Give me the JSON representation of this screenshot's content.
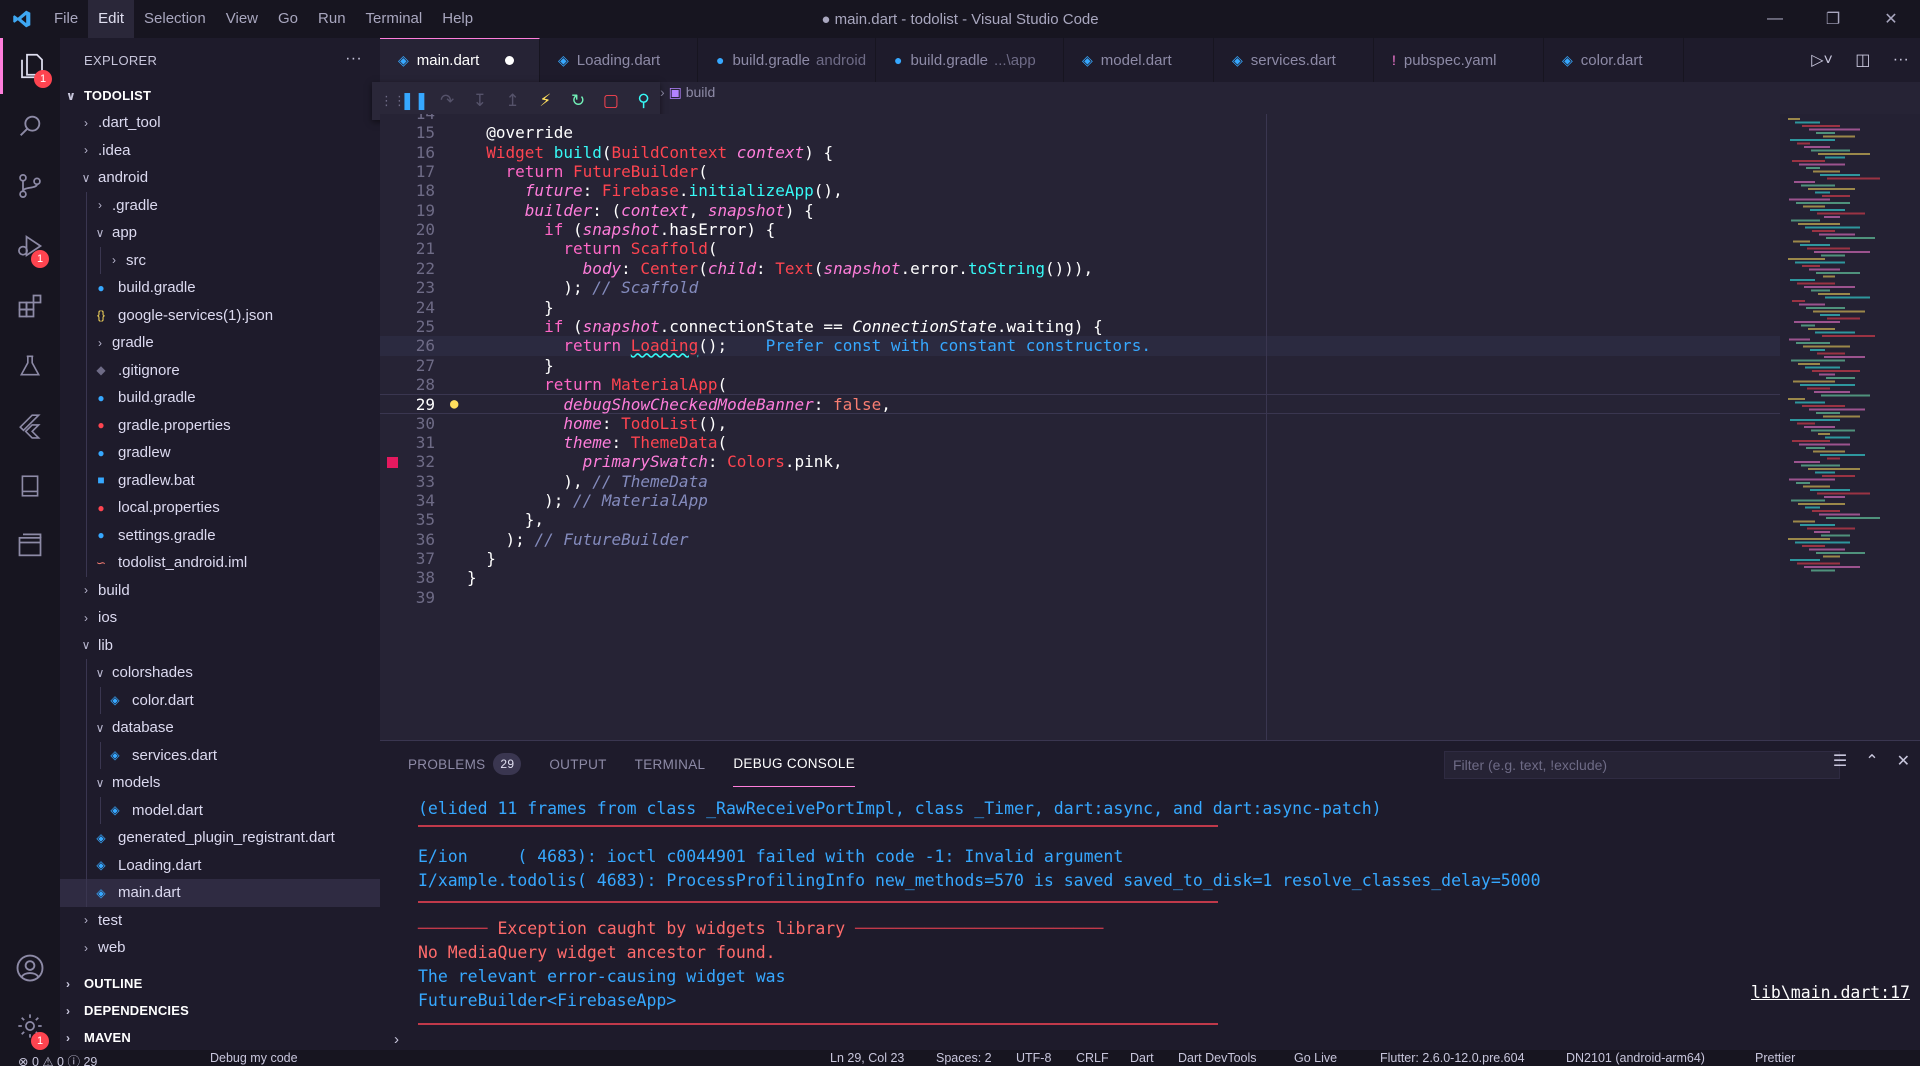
{
  "title_bar": {
    "menus": [
      "File",
      "Edit",
      "Selection",
      "View",
      "Go",
      "Run",
      "Terminal",
      "Help"
    ],
    "active_menu": "Edit",
    "window_title": "● main.dart - todolist - Visual Studio Code"
  },
  "activity_bar": {
    "explorer_badge": "1",
    "debug_badge": "1",
    "settings_badge": "1"
  },
  "sidebar": {
    "header": "EXPLORER",
    "more": "···",
    "root": "TODOLIST",
    "items": [
      {
        "label": ".dart_tool",
        "depth": 0,
        "type": "folder",
        "open": false
      },
      {
        "label": ".idea",
        "depth": 0,
        "type": "folder",
        "open": false
      },
      {
        "label": "android",
        "depth": 0,
        "type": "folder",
        "open": true
      },
      {
        "label": ".gradle",
        "depth": 1,
        "type": "folder",
        "open": false
      },
      {
        "label": "app",
        "depth": 1,
        "type": "folder",
        "open": true
      },
      {
        "label": "src",
        "depth": 2,
        "type": "folder",
        "open": false
      },
      {
        "label": "build.gradle",
        "depth": 1,
        "type": "gradle"
      },
      {
        "label": "google-services(1).json",
        "depth": 1,
        "type": "json"
      },
      {
        "label": "gradle",
        "depth": 1,
        "type": "folder",
        "open": false
      },
      {
        "label": ".gitignore",
        "depth": 1,
        "type": "git"
      },
      {
        "label": "build.gradle",
        "depth": 1,
        "type": "gradle"
      },
      {
        "label": "gradle.properties",
        "depth": 1,
        "type": "props"
      },
      {
        "label": "gradlew",
        "depth": 1,
        "type": "gradle"
      },
      {
        "label": "gradlew.bat",
        "depth": 1,
        "type": "bat"
      },
      {
        "label": "local.properties",
        "depth": 1,
        "type": "props"
      },
      {
        "label": "settings.gradle",
        "depth": 1,
        "type": "gradle"
      },
      {
        "label": "todolist_android.iml",
        "depth": 1,
        "type": "rss"
      },
      {
        "label": "build",
        "depth": 0,
        "type": "folder",
        "open": false
      },
      {
        "label": "ios",
        "depth": 0,
        "type": "folder",
        "open": false
      },
      {
        "label": "lib",
        "depth": 0,
        "type": "folder",
        "open": true
      },
      {
        "label": "colorshades",
        "depth": 1,
        "type": "folder",
        "open": true
      },
      {
        "label": "color.dart",
        "depth": 2,
        "type": "dart"
      },
      {
        "label": "database",
        "depth": 1,
        "type": "folder",
        "open": true
      },
      {
        "label": "services.dart",
        "depth": 2,
        "type": "dart"
      },
      {
        "label": "models",
        "depth": 1,
        "type": "folder",
        "open": true
      },
      {
        "label": "model.dart",
        "depth": 2,
        "type": "dart"
      },
      {
        "label": "generated_plugin_registrant.dart",
        "depth": 1,
        "type": "dart"
      },
      {
        "label": "Loading.dart",
        "depth": 1,
        "type": "dart"
      },
      {
        "label": "main.dart",
        "depth": 1,
        "type": "dart",
        "selected": true
      },
      {
        "label": "test",
        "depth": 0,
        "type": "folder",
        "open": false
      },
      {
        "label": "web",
        "depth": 0,
        "type": "folder",
        "open": false
      }
    ],
    "sections": [
      "OUTLINE",
      "DEPENDENCIES",
      "MAVEN"
    ]
  },
  "tabs": [
    {
      "label": "main.dart",
      "active": true,
      "dirty": true
    },
    {
      "label": "Loading.dart"
    },
    {
      "label": "build.gradle",
      "suffix": "android",
      "gradle": true
    },
    {
      "label": "build.gradle",
      "suffix": "...\\app",
      "gradle": true
    },
    {
      "label": "model.dart"
    },
    {
      "label": "services.dart"
    },
    {
      "label": "pubspec.yaml",
      "yaml": true
    },
    {
      "label": "color.dart"
    }
  ],
  "breadcrumb": "build",
  "editor": {
    "current_line": "29",
    "lines": [
      {
        "n": "14",
        "html": ""
      },
      {
        "n": "15",
        "html": "  <span class='anno'>@override</span>"
      },
      {
        "n": "16",
        "html": "  <span class='ty'>Widget</span> <span class='fn'>build</span><span class='pl'>(</span><span class='ty'>BuildContext</span> <span class='param'>context</span><span class='pl'>) {</span>"
      },
      {
        "n": "17",
        "html": "    <span class='kwp'>return</span> <span class='ty'>FutureBuilder</span><span class='pl'>(</span>"
      },
      {
        "n": "18",
        "html": "      <span class='param'>future</span><span class='pl'>: </span><span class='ty'>Firebase</span><span class='pl'>.</span><span class='fn'>initializeApp</span><span class='pl'>(),</span>"
      },
      {
        "n": "19",
        "html": "      <span class='param'>builder</span><span class='pl'>: (</span><span class='param'>context</span><span class='pl'>, </span><span class='param'>snapshot</span><span class='pl'>) {</span>"
      },
      {
        "n": "20",
        "html": "        <span class='kwp'>if</span> <span class='pl'>(</span><span class='param'>snapshot</span><span class='pl'>.hasError) {</span>"
      },
      {
        "n": "21",
        "html": "          <span class='kwp'>return</span> <span class='ty'>Scaffold</span><span class='pl'>(</span>"
      },
      {
        "n": "22",
        "html": "            <span class='param'>body</span><span class='pl'>: </span><span class='ty'>Center</span><span class='pl'>(</span><span class='param'>child</span><span class='pl'>: </span><span class='ty'>Text</span><span class='pl'>(</span><span class='param'>snapshot</span><span class='pl'>.error.</span><span class='fn'>toString</span><span class='pl'>())),</span>"
      },
      {
        "n": "23",
        "html": "          <span class='pl'>); </span><span class='cm'>// Scaffold</span>"
      },
      {
        "n": "24",
        "html": "        <span class='pl'>}</span>"
      },
      {
        "n": "25",
        "html": "        <span class='kwp'>if</span> <span class='pl'>(</span><span class='param'>snapshot</span><span class='pl'>.connectionState == </span><span class='ital' style='color:#ffffff'>ConnectionState</span><span class='pl'>.waiting) {</span>"
      },
      {
        "n": "26",
        "html": "          <span class='kwp'>return</span> <span class='ty' style='text-decoration: underline wavy #36f9f6'>Loading</span><span class='pl'>();</span>    <span class='fn' style='color:#36a8ff'>Prefer const with constant constructors.</span>",
        "hl": true
      },
      {
        "n": "27",
        "html": "        <span class='pl'>}</span>"
      },
      {
        "n": "28",
        "html": "        <span class='kwp'>return</span> <span class='ty'>MaterialApp</span><span class='pl'>(</span>"
      },
      {
        "n": "29",
        "html": "          <span class='param'>debugShowCheckedModeBanner</span><span class='pl'>: </span><span class='val'>false</span><span class='pl'>,</span>",
        "cur": true
      },
      {
        "n": "30",
        "html": "          <span class='param'>home</span><span class='pl'>: </span><span class='ty'>TodoList</span><span class='pl'>(),</span>"
      },
      {
        "n": "31",
        "html": "          <span class='param'>theme</span><span class='pl'>: </span><span class='ty'>ThemeData</span><span class='pl'>(</span>"
      },
      {
        "n": "32",
        "html": "            <span class='param'>primarySwatch</span><span class='pl'>: </span><span class='ty'>Colors</span><span class='pl'>.pink,</span>",
        "bp": true
      },
      {
        "n": "33",
        "html": "          <span class='pl'>), </span><span class='cm'>// ThemeData</span>"
      },
      {
        "n": "34",
        "html": "        <span class='pl'>); </span><span class='cm'>// MaterialApp</span>"
      },
      {
        "n": "35",
        "html": "      <span class='pl'>},</span>"
      },
      {
        "n": "36",
        "html": "    <span class='pl'>); </span><span class='cm'>// FutureBuilder</span>"
      },
      {
        "n": "37",
        "html": "  <span class='pl'>}</span>"
      },
      {
        "n": "38",
        "html": "<span class='pl'>}</span>"
      },
      {
        "n": "39",
        "html": ""
      }
    ]
  },
  "panel": {
    "tabs": [
      {
        "label": "PROBLEMS",
        "count": "29"
      },
      {
        "label": "OUTPUT"
      },
      {
        "label": "TERMINAL"
      },
      {
        "label": "DEBUG CONSOLE",
        "active": true
      }
    ],
    "filter_placeholder": "Filter (e.g. text, !exclude)",
    "console": [
      {
        "text": "(elided 11 frames from class _RawReceivePortImpl, class _Timer, dart:async, and dart:async-patch)",
        "cls": "c-blue"
      },
      {
        "text": "E/ion     ( 4683): ioctl c0044901 failed with code -1: Invalid argument",
        "cls": "c-blue"
      },
      {
        "text": "I/xample.todolis( 4683): ProcessProfilingInfo new_methods=570 is saved saved_to_disk=1 resolve_classes_delay=5000",
        "cls": "c-blue"
      },
      {
        "text": "Exception caught by widgets library",
        "cls": "c-red"
      },
      {
        "text": "No MediaQuery widget ancestor found.",
        "cls": "c-red"
      },
      {
        "text": "The relevant error-causing widget was",
        "cls": "c-blue"
      },
      {
        "text": "FutureBuilder<FirebaseApp>",
        "cls": "c-blue"
      }
    ],
    "link": "lib\\main.dart:17",
    "prompt": "›"
  },
  "status_bar": {
    "items": [
      {
        "text": "⊗ 0  ⚠ 0  ⓘ 29"
      },
      {
        "text": "Debug my code"
      },
      {
        "text": "Ln 29, Col 23"
      },
      {
        "text": "Spaces: 2"
      },
      {
        "text": "UTF-8"
      },
      {
        "text": "CRLF"
      },
      {
        "text": "Dart"
      },
      {
        "text": "Dart DevTools"
      },
      {
        "text": "Go Live"
      },
      {
        "text": "Flutter: 2.6.0-12.0.pre.604"
      },
      {
        "text": "DN2101 (android-arm64)"
      },
      {
        "text": "Prettier"
      }
    ]
  },
  "colors": {
    "accent": "#ff7edb",
    "background": "#262335",
    "sidebar": "#1e1b2b",
    "error": "#fe4450",
    "info": "#36a8ff"
  }
}
